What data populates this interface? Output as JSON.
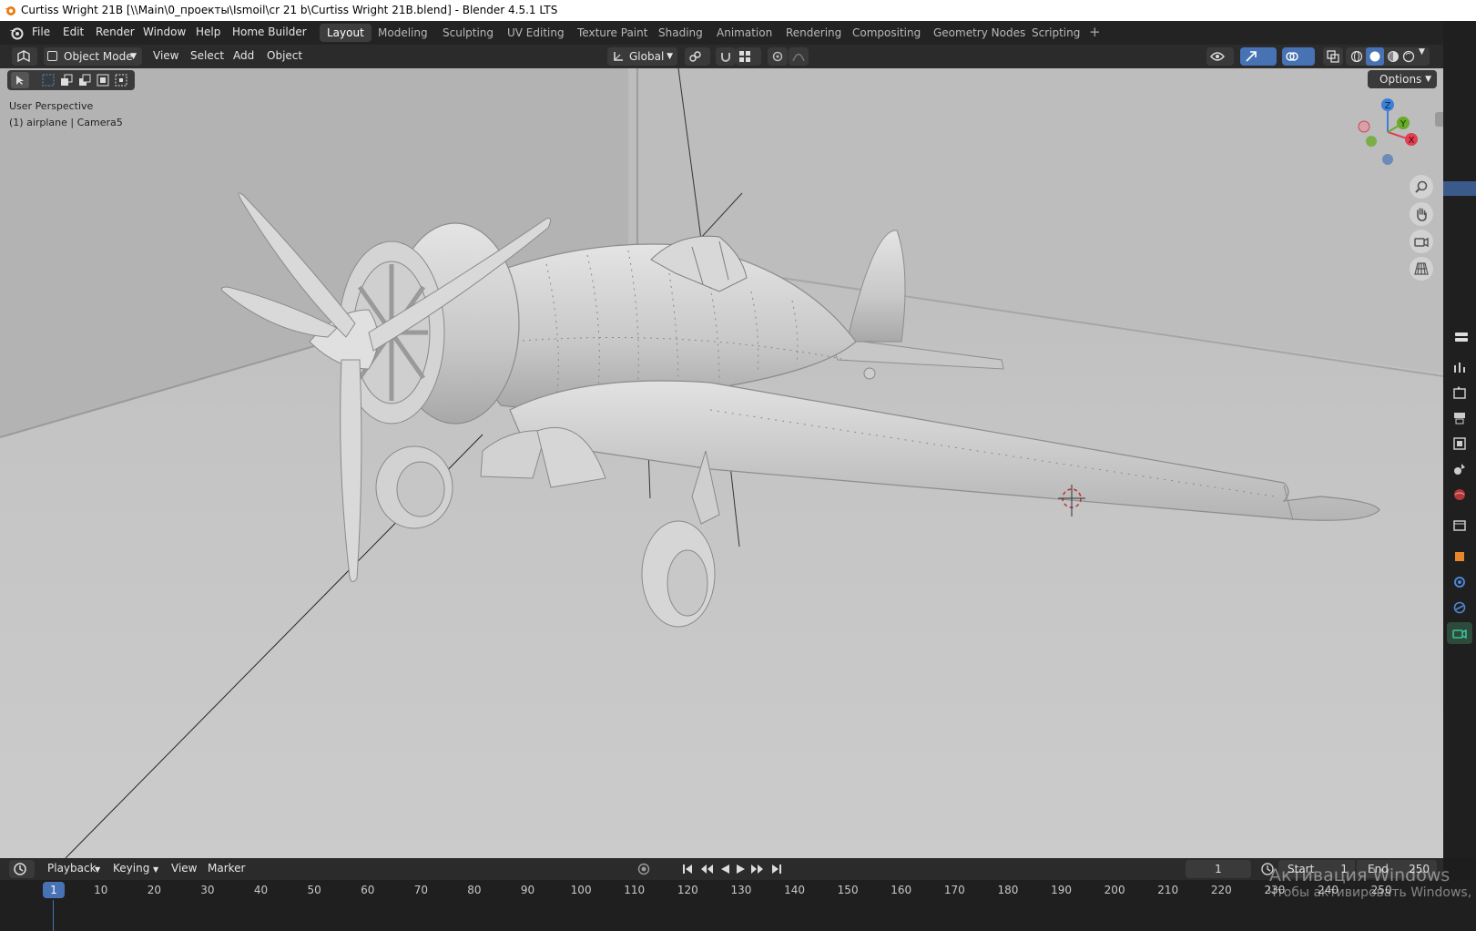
{
  "window_title": "Curtiss Wright 21B [\\\\Main\\0_проекты\\Ismoil\\cr 21 b\\Curtiss Wright 21B.blend] - Blender 4.5.1 LTS",
  "menus": [
    "File",
    "Edit",
    "Render",
    "Window",
    "Help",
    "Home Builder"
  ],
  "workspace_tabs": [
    {
      "label": "Layout",
      "active": true
    },
    {
      "label": "Modeling",
      "active": false
    },
    {
      "label": "Sculpting",
      "active": false
    },
    {
      "label": "UV Editing",
      "active": false
    },
    {
      "label": "Texture Paint",
      "active": false
    },
    {
      "label": "Shading",
      "active": false
    },
    {
      "label": "Animation",
      "active": false
    },
    {
      "label": "Rendering",
      "active": false
    },
    {
      "label": "Compositing",
      "active": false
    },
    {
      "label": "Geometry Nodes",
      "active": false
    },
    {
      "label": "Scripting",
      "active": false
    }
  ],
  "add_workspace": "+",
  "viewport_header": {
    "mode": "Object Mode",
    "menus": [
      "View",
      "Select",
      "Add",
      "Object"
    ],
    "transform_orientation": "Global",
    "options": "Options"
  },
  "viewport": {
    "perspective": "User Perspective",
    "active_object": "(1) airplane | Camera5",
    "gizmo_axes": [
      "Z",
      "Y",
      "X"
    ]
  },
  "timeline": {
    "menus": [
      "Playback",
      "Keying",
      "View",
      "Marker"
    ],
    "current_frame": "1",
    "start_label": "Start",
    "start_value": "1",
    "end_label": "End",
    "end_value": "250",
    "ruler": [
      "1",
      "10",
      "20",
      "30",
      "40",
      "50",
      "60",
      "70",
      "80",
      "90",
      "100",
      "110",
      "120",
      "130",
      "140",
      "150",
      "160",
      "170",
      "180",
      "190",
      "200",
      "210",
      "220",
      "230",
      "240",
      "250"
    ]
  },
  "watermark": {
    "line1": "Активация Windows",
    "line2": "Чтобы активировать Windows, пе"
  },
  "colors": {
    "viewport_bg": "#c2c2c2",
    "active_frame": "#4772b3",
    "axis_x": "#e0404f",
    "axis_y": "#6aaa2a",
    "axis_z": "#3b80d8"
  }
}
